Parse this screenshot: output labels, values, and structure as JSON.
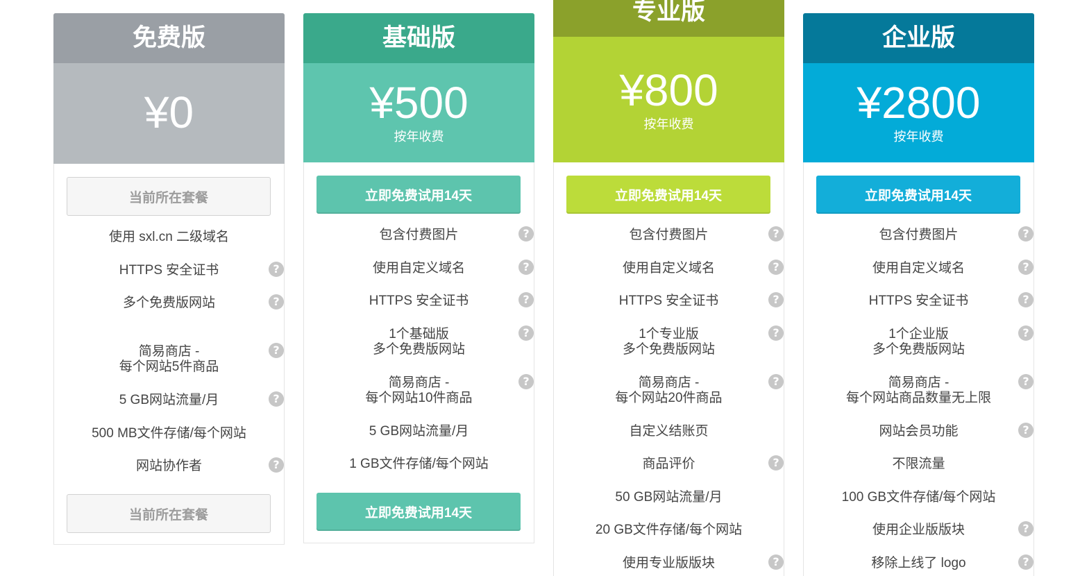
{
  "icons": {
    "help": "question-circle-icon"
  },
  "plans": [
    {
      "name": "免费版",
      "price": "¥0",
      "colors": {
        "header": "#9a9fa5",
        "price_bg": "#b5babe",
        "button": "#f6f6f6"
      },
      "top_button": "当前所在套餐",
      "bottom_button": "当前所在套餐",
      "features": [
        {
          "lines": [
            "使用 sxl.cn 二级域名"
          ],
          "help": false
        },
        {
          "lines": [
            "HTTPS 安全证书"
          ],
          "help": true
        },
        {
          "lines": [
            "多个免费版网站"
          ],
          "help": true
        },
        {
          "lines": [
            "简易商店 -",
            "每个网站5件商品"
          ],
          "help": true
        },
        {
          "lines": [
            "5 GB网站流量/月"
          ],
          "help": true
        },
        {
          "lines": [
            "500 MB文件存储/每个网站"
          ],
          "help": false
        },
        {
          "lines": [
            "网站协作者"
          ],
          "help": true
        }
      ]
    },
    {
      "name": "基础版",
      "price": "¥500",
      "billing": "按年收费",
      "colors": {
        "header": "#3aa98b",
        "price_bg": "#5ec5ae",
        "button": "#5dc4ad"
      },
      "top_button": "立即免费试用14天",
      "bottom_button": "立即免费试用14天",
      "features": [
        {
          "lines": [
            "包含付费图片"
          ],
          "help": true
        },
        {
          "lines": [
            "使用自定义域名"
          ],
          "help": true
        },
        {
          "lines": [
            "HTTPS 安全证书"
          ],
          "help": true
        },
        {
          "lines": [
            "1个基础版",
            "多个免费版网站"
          ],
          "help": true
        },
        {
          "lines": [
            "简易商店 -",
            "每个网站10件商品"
          ],
          "help": true
        },
        {
          "lines": [
            "5 GB网站流量/月"
          ],
          "help": false
        },
        {
          "lines": [
            "1 GB文件存储/每个网站"
          ],
          "help": false
        }
      ]
    },
    {
      "name": "专业版",
      "price": "¥800",
      "billing": "按年收费",
      "colors": {
        "header": "#8ba12b",
        "price_bg": "#b3d335",
        "button": "#bcdc3a"
      },
      "top_button": "立即免费试用14天",
      "features": [
        {
          "lines": [
            "包含付费图片"
          ],
          "help": true
        },
        {
          "lines": [
            "使用自定义域名"
          ],
          "help": true
        },
        {
          "lines": [
            "HTTPS 安全证书"
          ],
          "help": true
        },
        {
          "lines": [
            "1个专业版",
            "多个免费版网站"
          ],
          "help": true
        },
        {
          "lines": [
            "简易商店 -",
            "每个网站20件商品"
          ],
          "help": true
        },
        {
          "lines": [
            "自定义结账页"
          ],
          "help": false
        },
        {
          "lines": [
            "商品评价"
          ],
          "help": true
        },
        {
          "lines": [
            "50 GB网站流量/月"
          ],
          "help": false
        },
        {
          "lines": [
            "20 GB文件存储/每个网站"
          ],
          "help": false
        },
        {
          "lines": [
            "使用专业版版块"
          ],
          "help": true
        }
      ]
    },
    {
      "name": "企业版",
      "price": "¥2800",
      "billing": "按年收费",
      "colors": {
        "header": "#05799a",
        "price_bg": "#03abd8",
        "button": "#13aed9"
      },
      "top_button": "立即免费试用14天",
      "features": [
        {
          "lines": [
            "包含付费图片"
          ],
          "help": true
        },
        {
          "lines": [
            "使用自定义域名"
          ],
          "help": true
        },
        {
          "lines": [
            "HTTPS 安全证书"
          ],
          "help": true
        },
        {
          "lines": [
            "1个企业版",
            "多个免费版网站"
          ],
          "help": true
        },
        {
          "lines": [
            "简易商店 -",
            "每个网站商品数量无上限"
          ],
          "help": true
        },
        {
          "lines": [
            "网站会员功能"
          ],
          "help": true
        },
        {
          "lines": [
            "不限流量"
          ],
          "help": false
        },
        {
          "lines": [
            "100 GB文件存储/每个网站"
          ],
          "help": false
        },
        {
          "lines": [
            "使用企业版版块"
          ],
          "help": true
        },
        {
          "lines": [
            "移除上线了 logo"
          ],
          "help": true
        }
      ]
    }
  ]
}
